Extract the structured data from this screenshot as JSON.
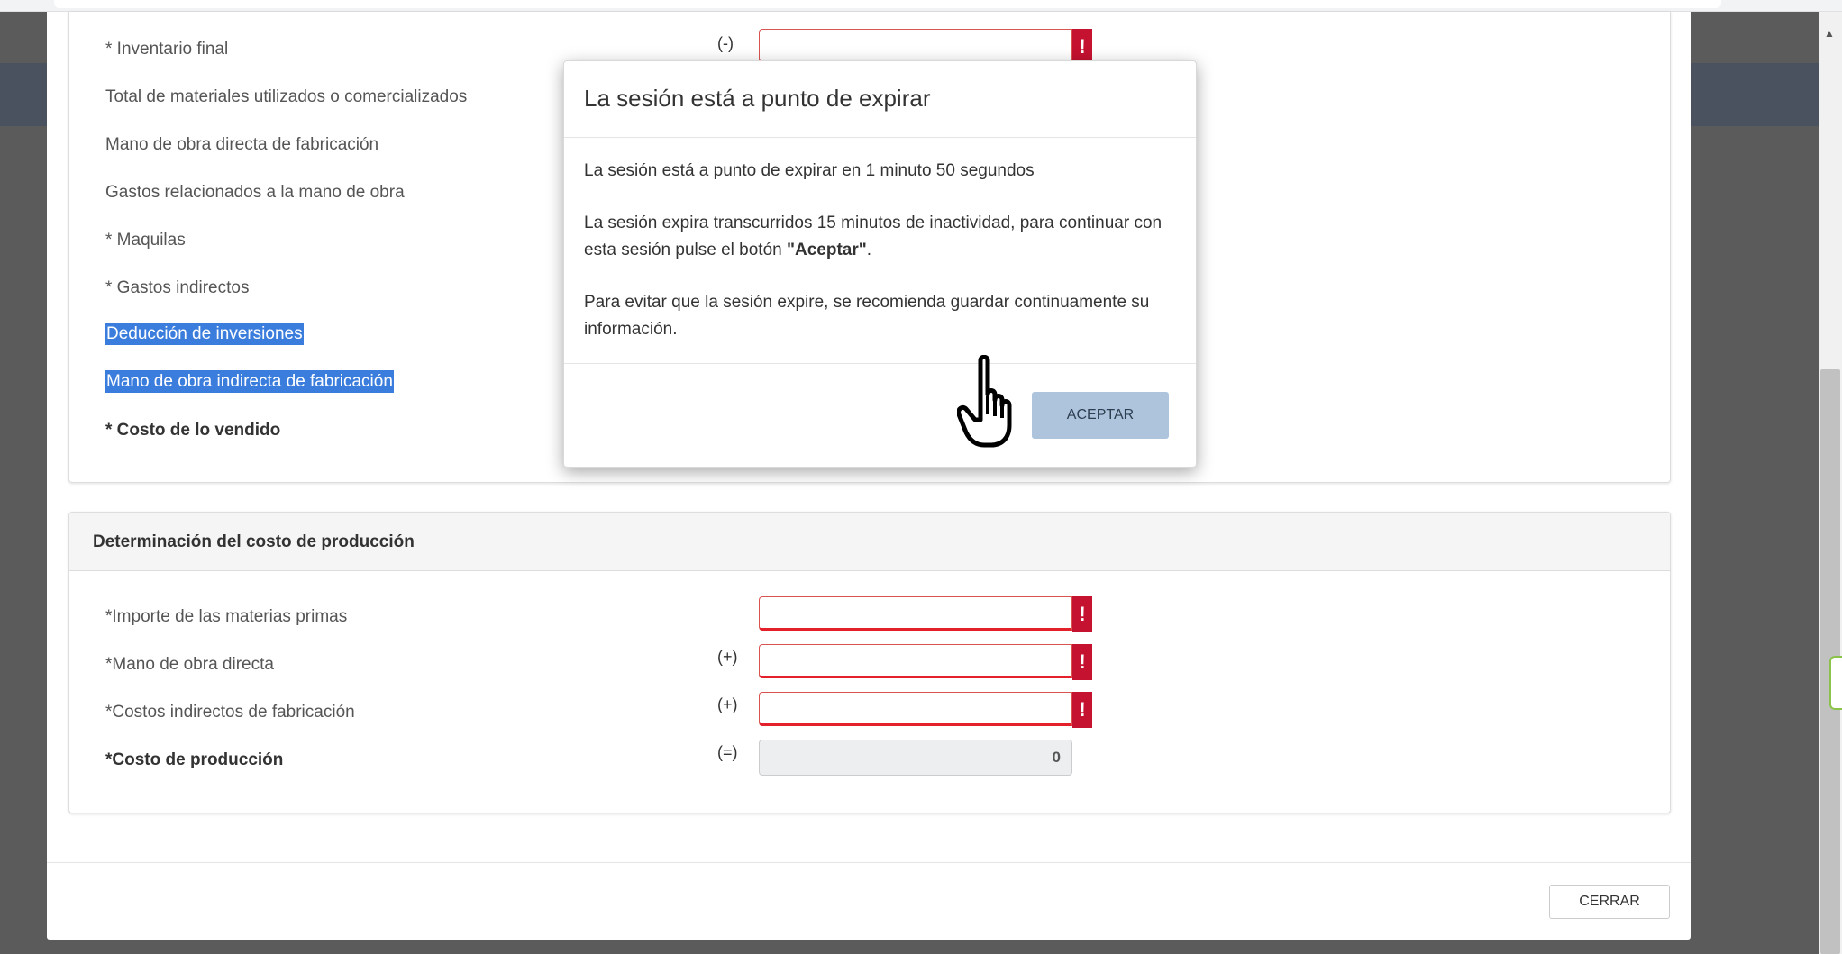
{
  "section1": {
    "rows": [
      {
        "label": "* Inventario final",
        "sign": "(-)"
      },
      {
        "label": "Total de materiales utilizados o comercializados"
      },
      {
        "label": "Mano de obra directa de fabricación"
      },
      {
        "label": "Gastos relacionados a la mano de obra"
      },
      {
        "label": "* Maquilas"
      },
      {
        "label": "* Gastos indirectos"
      },
      {
        "label": "Deducción de inversiones"
      },
      {
        "label": "Mano de obra indirecta de fabricación"
      },
      {
        "label": "* Costo de lo vendido"
      }
    ]
  },
  "section2": {
    "title": "Determinación del costo de producción",
    "rows": [
      {
        "label": "*Importe de las materias primas",
        "sign": ""
      },
      {
        "label": "*Mano de obra directa",
        "sign": "(+)"
      },
      {
        "label": "*Costos indirectos de fabricación",
        "sign": "(+)"
      },
      {
        "label": "*Costo de producción",
        "sign": "(=)",
        "value": "0"
      }
    ]
  },
  "error_marker": "!",
  "close_label": "CERRAR",
  "dialog": {
    "title": "La sesión está a punto de expirar",
    "line1": "La sesión está a punto de expirar en 1 minuto 50 segundos",
    "line2_pre": "La sesión expira transcurridos 15 minutos de inactividad, para continuar con esta sesión pulse el botón ",
    "line2_bold": "\"Aceptar\"",
    "line2_post": ".",
    "line3": "Para evitar que la sesión expire, se recomienda guardar continuamente su información.",
    "accept_label": "ACEPTAR"
  },
  "colors": {
    "error": "#c41230",
    "accept_button": "#aec4dd",
    "selection": "#3b7ddd"
  },
  "icons": {
    "cursor": "hand-pointer-icon",
    "error": "exclamation-icon"
  }
}
